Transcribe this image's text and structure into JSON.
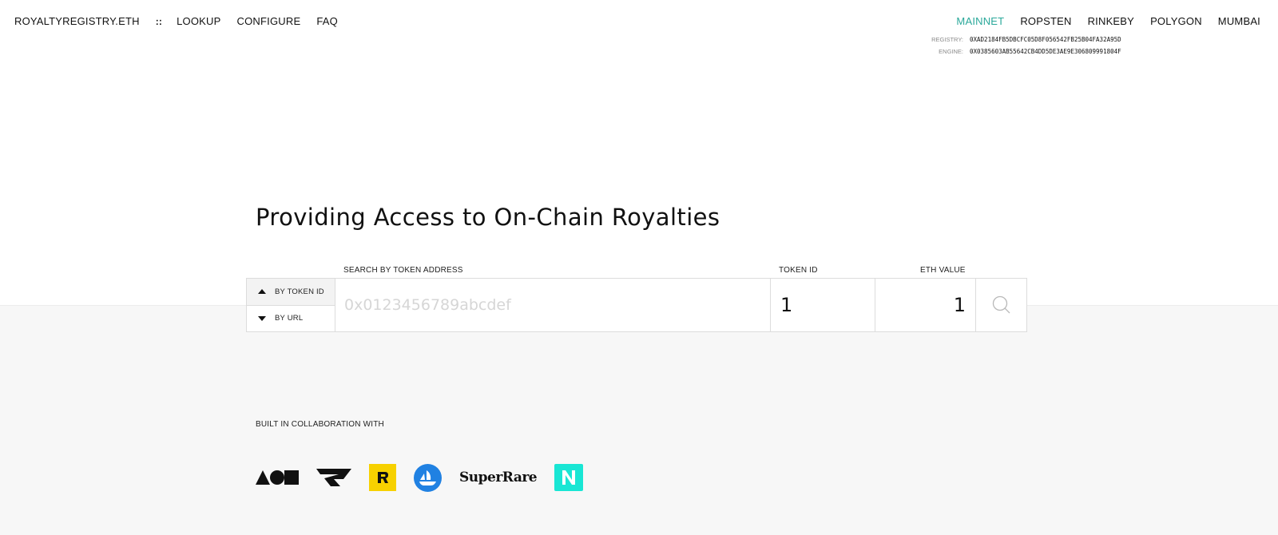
{
  "header": {
    "brand": "ROYALTYREGISTRY.ETH",
    "separator": "::",
    "links": [
      "LOOKUP",
      "CONFIGURE",
      "FAQ"
    ],
    "networks": [
      "MAINNET",
      "ROPSTEN",
      "RINKEBY",
      "POLYGON",
      "MUMBAI"
    ],
    "active_network": "MAINNET",
    "registry_label": "REGISTRY:",
    "registry_address": "0XAD2184FB5DBCFC05D8F056542FB25B04FA32A95D",
    "engine_label": "ENGINE:",
    "engine_address": "0X0385603AB55642CB4DD5DE3AE9E306809991804F"
  },
  "hero": {
    "title": "Providing Access to On-Chain Royalties"
  },
  "search": {
    "address_label": "SEARCH BY TOKEN ADDRESS",
    "token_label": "TOKEN ID",
    "eth_label": "ETH VALUE",
    "mode_token": "BY TOKEN ID",
    "mode_url": "BY URL",
    "address_placeholder": "0x0123456789abcdef",
    "token_value": "1",
    "eth_value": "1"
  },
  "collab": {
    "label": "BUILT IN COLLABORATION WITH",
    "superrare": "SuperRare"
  },
  "colors": {
    "accent": "#2aa89a",
    "bottom_bg": "#f7f7f7",
    "rarible_yellow": "#f7d100",
    "opensea_blue": "#2081e2",
    "nifty_teal": "#19e6d4"
  },
  "icons": [
    "search-icon",
    "triangle-up-icon",
    "triangle-down-icon"
  ]
}
